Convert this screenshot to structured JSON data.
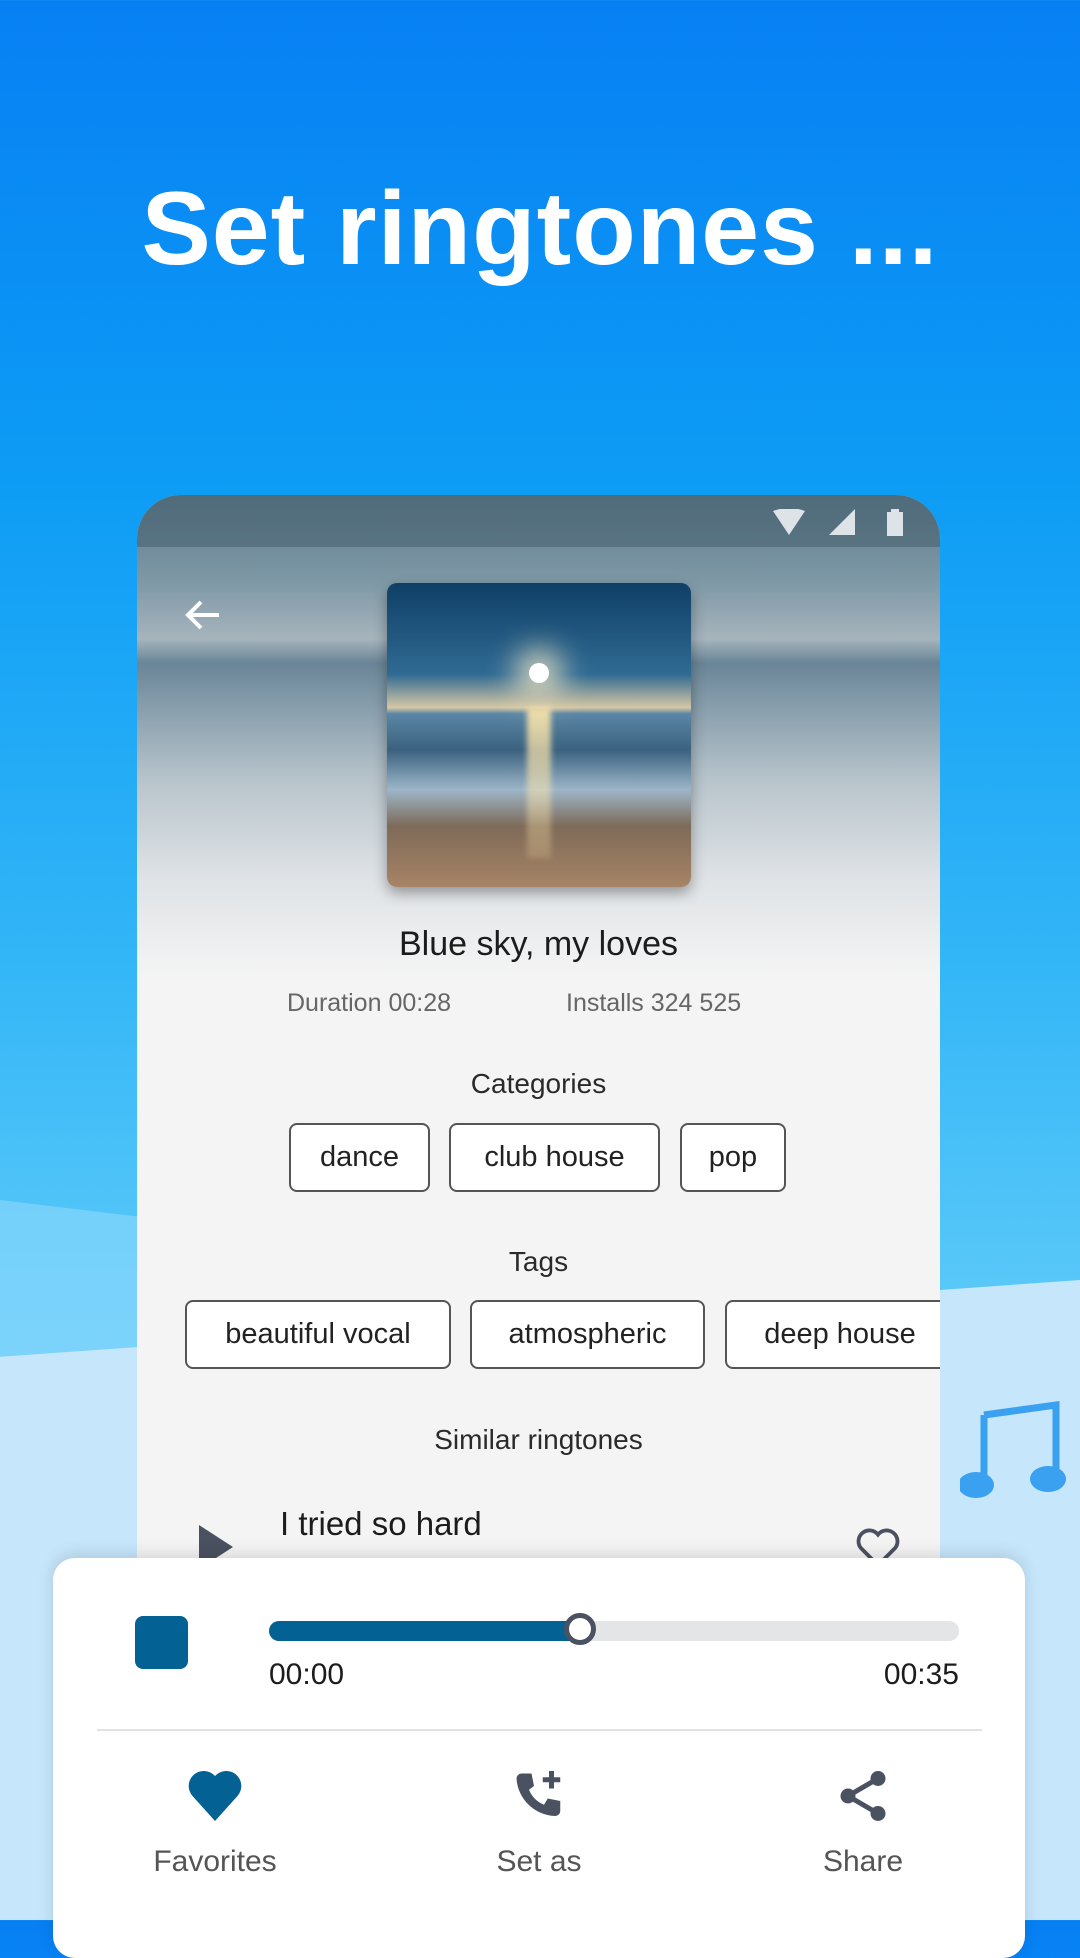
{
  "headline": "Set ringtones ...",
  "ringtone": {
    "title": "Blue sky, my loves",
    "duration": "Duration 00:28",
    "installs": "Installs 324 525"
  },
  "categories": {
    "label": "Categories",
    "items": [
      "dance",
      "club house",
      "pop"
    ]
  },
  "tags": {
    "label": "Tags",
    "items": [
      "beautiful vocal",
      "atmospheric",
      "deep house"
    ]
  },
  "similar": {
    "label": "Similar ringtones",
    "items": [
      {
        "title": "I tried so hard"
      }
    ]
  },
  "player": {
    "start_time": "00:00",
    "end_time": "00:35",
    "progress": 0.45
  },
  "actions": [
    {
      "label": "Favorites",
      "icon": "heart-icon"
    },
    {
      "label": "Set as",
      "icon": "phone-add-icon"
    },
    {
      "label": "Share",
      "icon": "share-icon"
    }
  ],
  "colors": {
    "accent": "#036193",
    "background": "#0d9cf5"
  }
}
